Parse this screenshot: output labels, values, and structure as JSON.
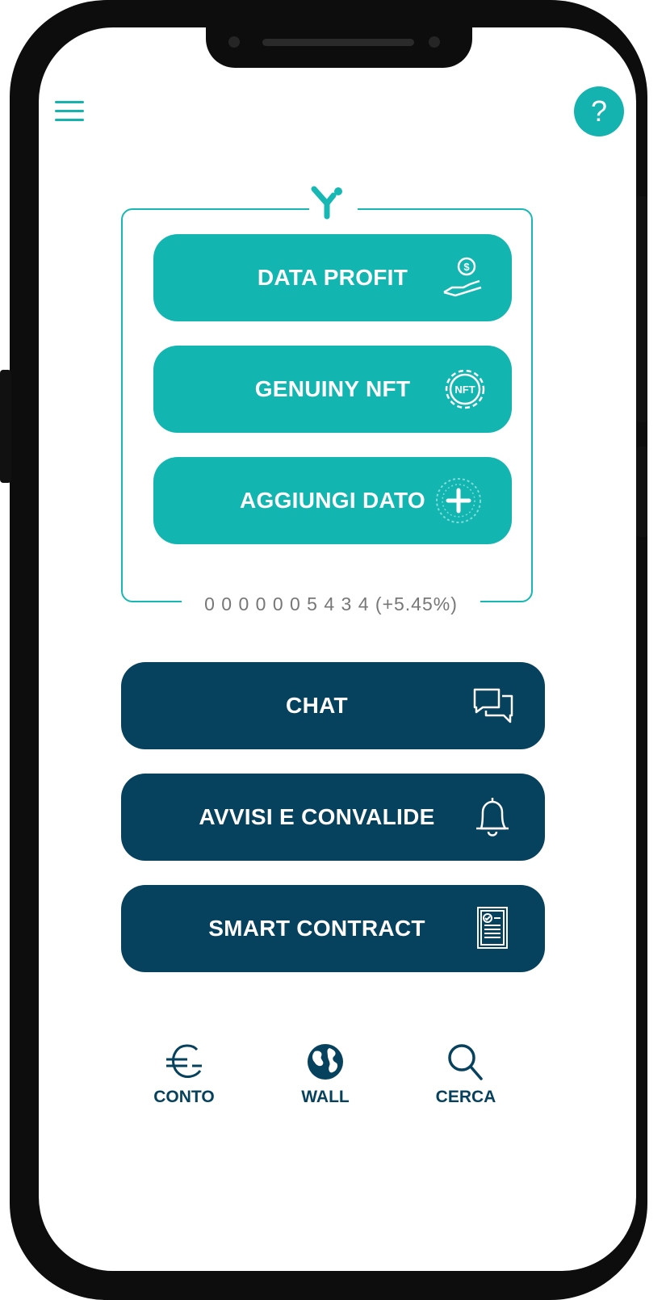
{
  "header": {
    "menu_icon": "hamburger-icon",
    "help_label": "?"
  },
  "card": {
    "logo_icon": "y-logo-icon",
    "buttons": [
      {
        "label": "DATA PROFIT",
        "icon": "hand-coin-icon"
      },
      {
        "label": "GENUINY NFT",
        "icon": "nft-gear-icon"
      },
      {
        "label": "AGGIUNGI DATO",
        "icon": "add-data-plus-icon"
      }
    ],
    "counter": "0 0 0 0 0 0 5 4 3 4 (+5.45%)"
  },
  "actions": [
    {
      "label": "CHAT",
      "icon": "chat-bubbles-icon"
    },
    {
      "label": "AVVISI E CONVALIDE",
      "icon": "bell-icon"
    },
    {
      "label": "SMART CONTRACT",
      "icon": "document-check-icon"
    }
  ],
  "tabs": [
    {
      "label": "CONTO",
      "icon": "euro-icon"
    },
    {
      "label": "WALL",
      "icon": "globe-icon"
    },
    {
      "label": "CERCA",
      "icon": "search-icon"
    }
  ],
  "colors": {
    "teal": "#13b5b1",
    "navy": "#06415e",
    "background": "#ffffff"
  }
}
